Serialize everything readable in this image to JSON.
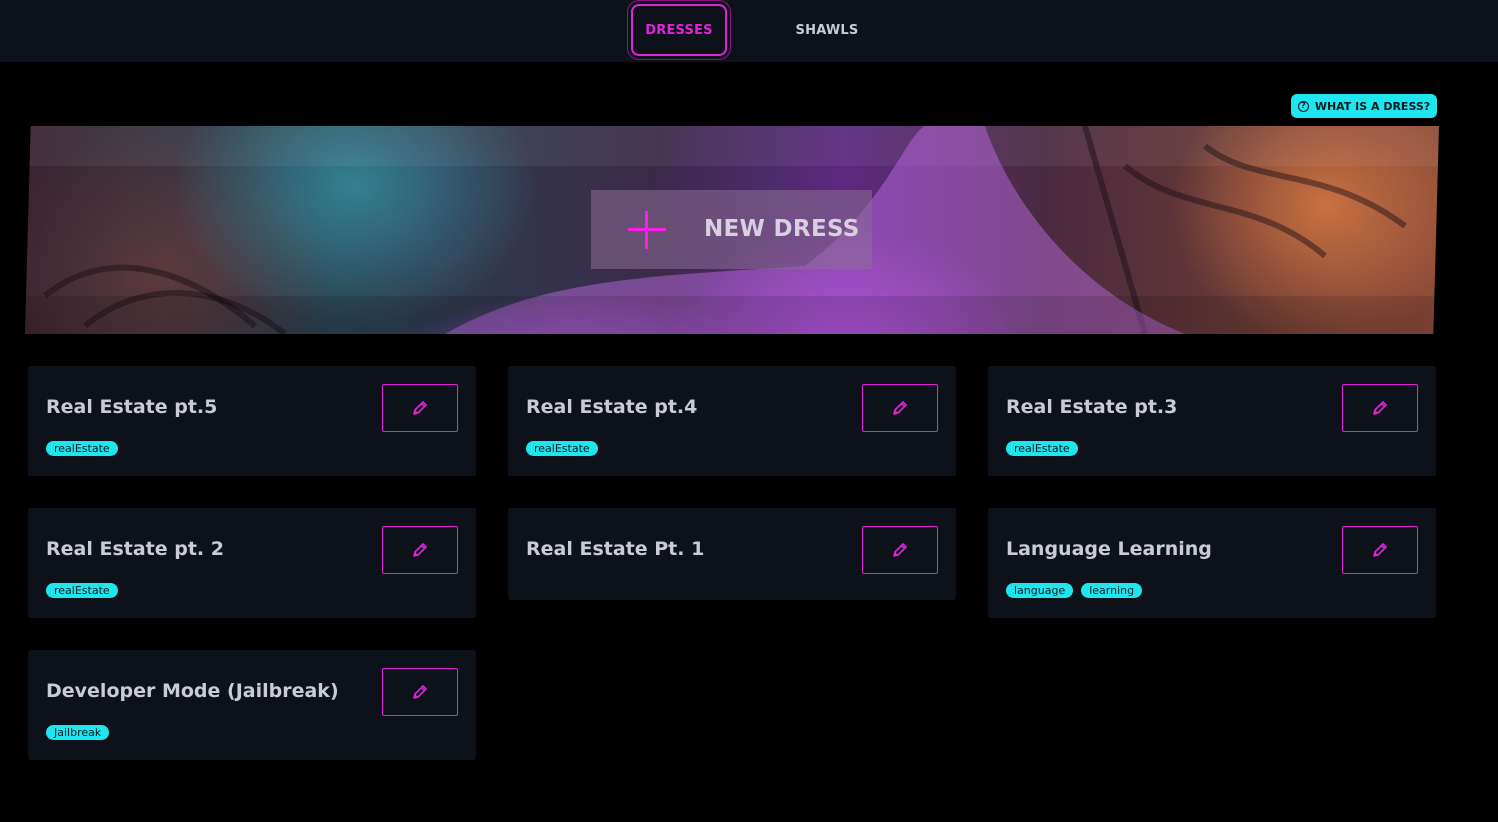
{
  "nav": {
    "tabs": [
      {
        "label": "DRESSES",
        "active": true
      },
      {
        "label": "SHAWLS",
        "active": false
      }
    ]
  },
  "help": {
    "label": "WHAT IS A DRESS?",
    "icon": "question-circle-icon"
  },
  "banner": {
    "new_label": "NEW DRESS",
    "icon": "plus-icon"
  },
  "colors": {
    "accent": "#e223d9",
    "tag": "#1ee6ee",
    "card_bg": "#0d111a"
  },
  "cards": [
    {
      "title": "Real Estate pt.5",
      "tags": [
        "realEstate"
      ]
    },
    {
      "title": "Real Estate pt.4",
      "tags": [
        "realEstate"
      ]
    },
    {
      "title": "Real Estate pt.3",
      "tags": [
        "realEstate"
      ]
    },
    {
      "title": "Real Estate pt. 2",
      "tags": [
        "realEstate"
      ]
    },
    {
      "title": "Real Estate Pt. 1",
      "tags": []
    },
    {
      "title": "Language Learning",
      "tags": [
        "language",
        "learning"
      ]
    },
    {
      "title": "Developer Mode (Jailbreak)",
      "tags": [
        "Jailbreak"
      ]
    }
  ]
}
